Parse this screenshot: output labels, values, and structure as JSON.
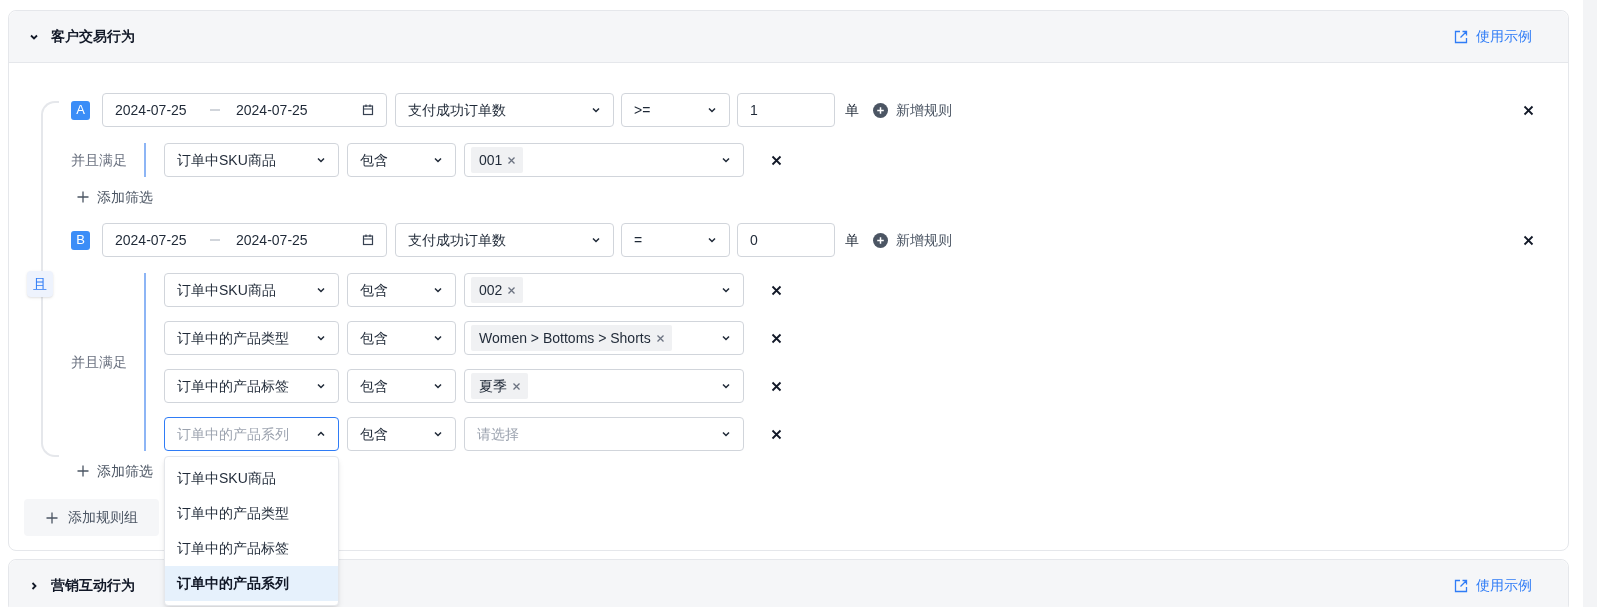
{
  "sections": [
    {
      "title": "客户交易行为",
      "expanded": true,
      "link": "使用示例",
      "connector": "且",
      "add_group": "添加规则组",
      "groups": [
        {
          "badge": "A",
          "date_start": "2024-07-25",
          "date_end": "2024-07-25",
          "metric": "支付成功订单数",
          "operator": ">=",
          "count": "1",
          "unit": "单",
          "add_rule": "新增规则",
          "filter_label": "并且满足",
          "add_filter": "添加筛选",
          "filters": [
            {
              "field": "订单中SKU商品",
              "open": false,
              "operator": "包含",
              "values": [
                "001"
              ]
            }
          ]
        },
        {
          "badge": "B",
          "date_start": "2024-07-25",
          "date_end": "2024-07-25",
          "metric": "支付成功订单数",
          "operator": "=",
          "count": "0",
          "unit": "单",
          "add_rule": "新增规则",
          "filter_label": "并且满足",
          "add_filter": "添加筛选",
          "filters": [
            {
              "field": "订单中SKU商品",
              "open": false,
              "operator": "包含",
              "values": [
                "002"
              ]
            },
            {
              "field": "订单中的产品类型",
              "open": false,
              "operator": "包含",
              "values": [
                "Women > Bottoms > Shorts"
              ]
            },
            {
              "field": "订单中的产品标签",
              "open": false,
              "operator": "包含",
              "values": [
                "夏季"
              ]
            },
            {
              "field": "订单中的产品系列",
              "open": true,
              "operator": "包含",
              "placeholder": "请选择",
              "options": [
                {
                  "label": "订单中SKU商品",
                  "selected": false
                },
                {
                  "label": "订单中的产品类型",
                  "selected": false
                },
                {
                  "label": "订单中的产品标签",
                  "selected": false
                },
                {
                  "label": "订单中的产品系列",
                  "selected": true
                }
              ]
            }
          ]
        }
      ]
    },
    {
      "title": "营销互动行为",
      "expanded": false,
      "link": "使用示例"
    }
  ]
}
